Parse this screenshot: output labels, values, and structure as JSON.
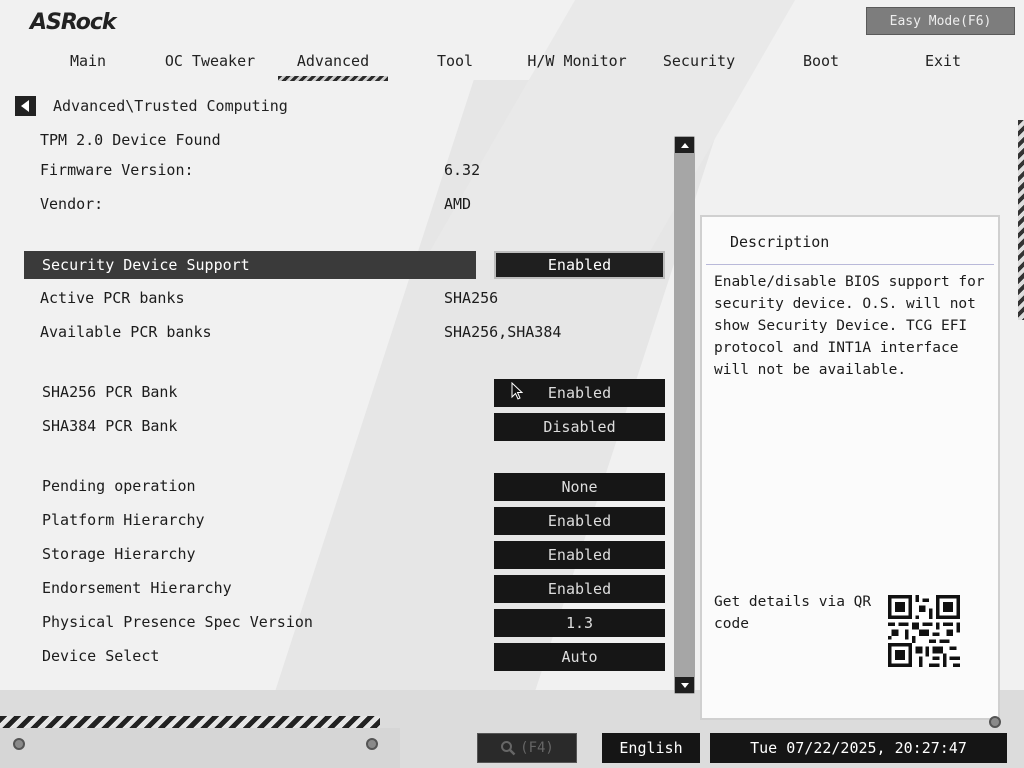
{
  "brand": "ASRock",
  "easy_mode_label": "Easy Mode(F6)",
  "tabs": [
    {
      "label": "Main"
    },
    {
      "label": "OC Tweaker"
    },
    {
      "label": "Advanced",
      "active": true
    },
    {
      "label": "Tool"
    },
    {
      "label": "H/W Monitor"
    },
    {
      "label": "Security"
    },
    {
      "label": "Boot"
    },
    {
      "label": "Exit"
    }
  ],
  "breadcrumb": "Advanced\\Trusted Computing",
  "info": {
    "tpm_found": "TPM 2.0 Device Found",
    "firmware_label": "Firmware Version:",
    "firmware_value": "6.32",
    "vendor_label": "Vendor:",
    "vendor_value": "AMD",
    "active_banks_label": "Active PCR banks",
    "active_banks_value": "SHA256",
    "available_banks_label": "Available PCR banks",
    "available_banks_value": "SHA256,SHA384"
  },
  "settings": {
    "security_device_support": {
      "label": "Security Device Support",
      "value": "Enabled"
    },
    "sha256_bank": {
      "label": "SHA256 PCR Bank",
      "value": "Enabled"
    },
    "sha384_bank": {
      "label": "SHA384 PCR Bank",
      "value": "Disabled"
    },
    "pending_operation": {
      "label": "Pending operation",
      "value": "None"
    },
    "platform_hierarchy": {
      "label": "Platform Hierarchy",
      "value": "Enabled"
    },
    "storage_hierarchy": {
      "label": "Storage Hierarchy",
      "value": "Enabled"
    },
    "endorsement_hierarchy": {
      "label": "Endorsement Hierarchy",
      "value": "Enabled"
    },
    "pp_spec_version": {
      "label": "Physical Presence Spec Version",
      "value": "1.3"
    },
    "device_select": {
      "label": "Device Select",
      "value": "Auto"
    }
  },
  "description": {
    "title": "Description",
    "text": "Enable/disable BIOS support for security device. O.S. will not show Security Device. TCG EFI protocol and INT1A interface will not be available.",
    "qr_label": "Get details via QR code"
  },
  "footer": {
    "search_label": "(F4)",
    "language": "English",
    "datetime": "Tue 07/22/2025, 20:27:47"
  },
  "colors": {
    "background": "#f1f1f1",
    "option_bg": "#161616",
    "highlight_bg": "#3a3a3a"
  }
}
